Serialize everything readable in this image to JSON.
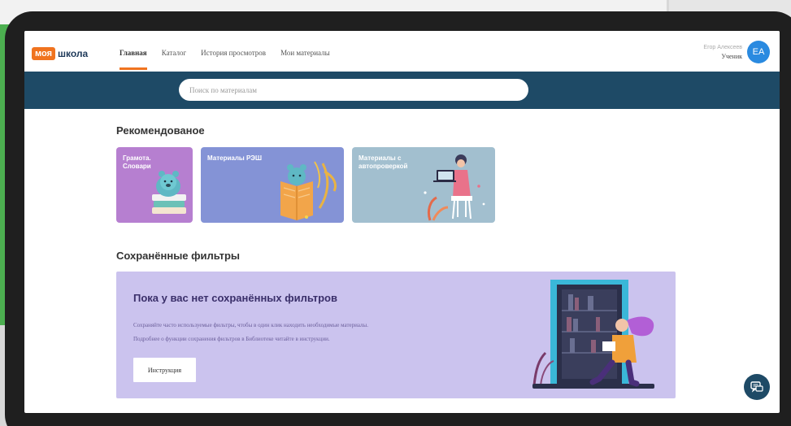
{
  "header": {
    "logo_part1": "моя",
    "logo_part2": "школа",
    "nav": [
      {
        "label": "Главная",
        "active": true
      },
      {
        "label": "Каталог",
        "active": false
      },
      {
        "label": "История просмотров",
        "active": false
      },
      {
        "label": "Мои материалы",
        "active": false
      }
    ],
    "user": {
      "name": "Егор Алексеев",
      "role": "Ученик",
      "initials": "ЕА"
    }
  },
  "search": {
    "placeholder": "Поиск по материалам"
  },
  "recommended": {
    "title": "Рекомендованое",
    "cards": [
      {
        "label_line1": "Грамота.",
        "label_line2": "Словари"
      },
      {
        "label_line1": "Материалы РЭШ",
        "label_line2": ""
      },
      {
        "label_line1": "Материалы с",
        "label_line2": "автопроверкой"
      }
    ]
  },
  "saved_filters": {
    "title": "Сохранённые фильтры",
    "empty_title": "Пока у вас нет сохранённых фильтров",
    "text_line1": "Сохраняйте часто используемые фильтры, чтобы в один клик находить необходимые материалы.",
    "text_line2": "Подробнее о функции сохранения фильтров в Библиотеке читайте в инструкции.",
    "button_label": "Инструкция"
  },
  "colors": {
    "accent": "#f0731f",
    "navy": "#1e4a66",
    "avatar": "#2a8ae0",
    "card1": "#b67fd0",
    "card2": "#8493d6",
    "card3": "#a2bfcf",
    "panel": "#cbc3ee"
  },
  "icons": {
    "chat": "chat-support-icon"
  }
}
